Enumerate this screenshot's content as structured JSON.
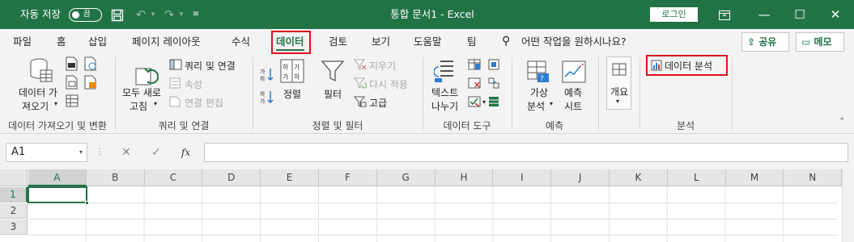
{
  "titlebar": {
    "autosave_label": "자동 저장",
    "autosave_state": "끔",
    "title": "통합 문서1  -  Excel",
    "login_label": "로그인"
  },
  "tabs": [
    "파일",
    "홈",
    "삽입",
    "페이지 레이아웃",
    "수식",
    "데이터",
    "검토",
    "보기",
    "도움말",
    "팀"
  ],
  "active_tab": "데이터",
  "tell_me": "어떤 작업을 원하시나요?",
  "share_label": "공유",
  "comments_label": "메모",
  "ribbon": {
    "get_data": {
      "label1": "데이터 가",
      "label2": "져오기"
    },
    "refresh_all": {
      "label1": "모두 새로",
      "label2": "고침"
    },
    "queries_connections": "쿼리 및 연결",
    "properties": "속성",
    "edit_links": "연결 편집",
    "sort": "정렬",
    "filter": "필터",
    "clear": "지우기",
    "reapply": "다시 적용",
    "advanced": "고급",
    "text_to_columns": {
      "label1": "텍스트",
      "label2": "나누기"
    },
    "what_if": {
      "label1": "가상",
      "label2": "분석"
    },
    "forecast_sheet": {
      "label1": "예측",
      "label2": "시트"
    },
    "outline": "개요",
    "data_analysis": "데이터 분석",
    "groups": {
      "get_transform": "데이터 가져오기 및 변환",
      "queries": "쿼리 및 연결",
      "sort_filter": "정렬 및 필터",
      "data_tools": "데이터 도구",
      "forecast": "예측",
      "analysis": "분석"
    }
  },
  "formula_bar": {
    "name_box": "A1",
    "fx": "fx",
    "value": ""
  },
  "grid": {
    "columns": [
      "A",
      "B",
      "C",
      "D",
      "E",
      "F",
      "G",
      "H",
      "I",
      "J",
      "K",
      "L",
      "M",
      "N"
    ],
    "rows": [
      "1",
      "2",
      "3"
    ],
    "selected_cell": "A1"
  },
  "colors": {
    "accent": "#217346",
    "highlight": "#e0101a"
  }
}
